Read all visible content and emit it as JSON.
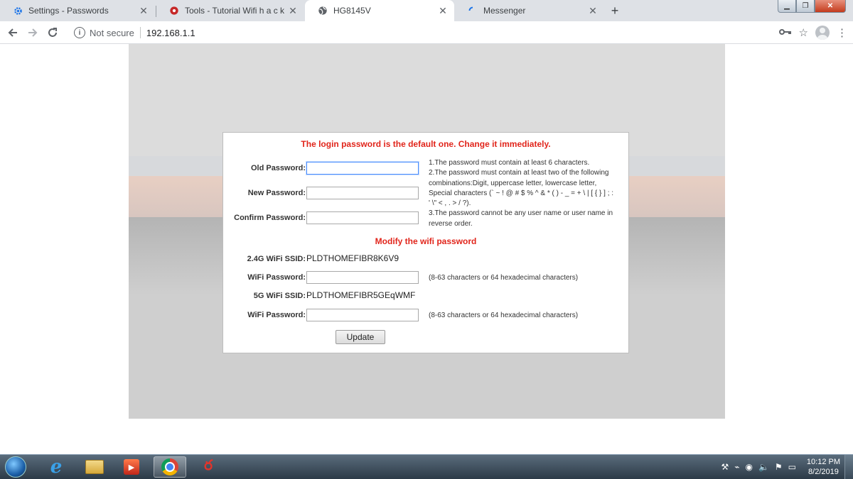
{
  "browser": {
    "tabs": [
      {
        "title": "Settings - Passwords",
        "icon": "gear-icon",
        "active": false
      },
      {
        "title": "Tools - Tutorial Wifi h a c k i n g",
        "icon": "tools-icon",
        "active": false
      },
      {
        "title": "HG8145V",
        "icon": "globe-icon",
        "active": true
      },
      {
        "title": "Messenger",
        "icon": "loading-icon",
        "active": false
      }
    ],
    "new_tab": "+",
    "address": {
      "security": "Not secure",
      "url": "192.168.1.1"
    }
  },
  "dialog": {
    "title": "The login password is the default one. Change it immediately.",
    "old_password_label": "Old Password:",
    "new_password_label": "New Password:",
    "confirm_password_label": "Confirm Password:",
    "rules": [
      "1.The password must contain at least 6 characters.",
      "2.The password must contain at least two of the following combinations:Digit, uppercase letter, lowercase letter, Special characters (` ~ ! @ # $ % ^ & * ( ) - _ = + \\ | [ { } ] ; : ' \\\" < , . > / ?).",
      "3.The password cannot be any user name or user name in reverse order."
    ],
    "wifi_title": "Modify the wifi password",
    "ssid_24_label": "2.4G WiFi SSID:",
    "ssid_24_value": "PLDTHOMEFIBR8K6V9",
    "wifi_pw_label_1": "WiFi Password:",
    "wifi_hint_1": "(8-63 characters or 64 hexadecimal characters)",
    "ssid_5_label": "5G WiFi SSID:",
    "ssid_5_value": "PLDTHOMEFIBR5GEqWMF",
    "wifi_pw_label_2": "WiFi Password:",
    "wifi_hint_2": "(8-63 characters or 64 hexadecimal characters)",
    "update_label": "Update"
  },
  "taskbar": {
    "clock_time": "10:12 PM",
    "clock_date": "8/2/2019"
  },
  "colors": {
    "warning_red": "#e1251b",
    "tab_strip": "#dee1e6",
    "taskbar": "#2c3a47"
  }
}
